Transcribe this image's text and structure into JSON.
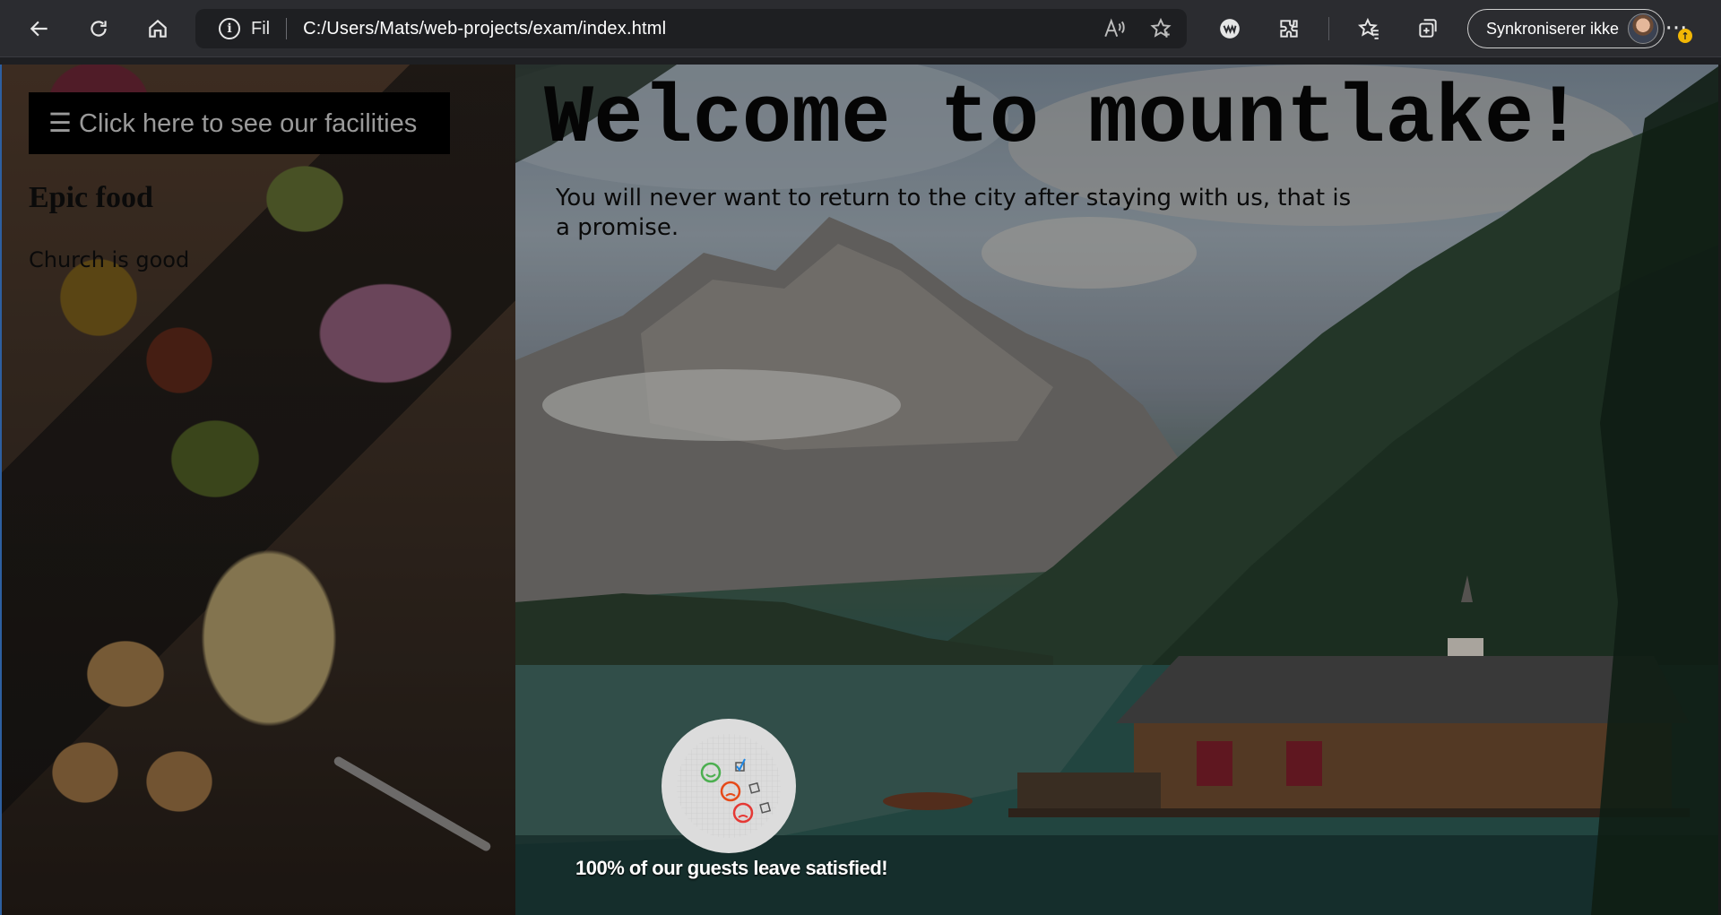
{
  "browser": {
    "site_info_label": "Fil",
    "url": "C:/Users/Mats/web-projects/exam/index.html",
    "sync_label": "Synkroniserer ikke",
    "more_label": "···",
    "icons": [
      "back-icon",
      "refresh-icon",
      "home-icon",
      "info-icon",
      "read-aloud-icon",
      "add-favorite-icon",
      "wallet-icon",
      "extensions-icon",
      "favorites-icon",
      "collections-icon",
      "more-icon"
    ]
  },
  "page": {
    "facilities_button": "☰ Click here to see our facilities",
    "food_heading": "Epic food",
    "food_text": "Church is good",
    "welcome_heading": "Welcome to mountlake!",
    "tagline": "You will never want to return to the city after staying with us, that is a promise.",
    "satisfaction_text": "100% of our guests leave satisfied!"
  },
  "colors": {
    "chrome_bg": "#2b2c30",
    "omnibox_bg": "#1e1f22",
    "button_bg": "#000000",
    "button_text": "#9a9a9a",
    "heading_text": "#050505"
  }
}
